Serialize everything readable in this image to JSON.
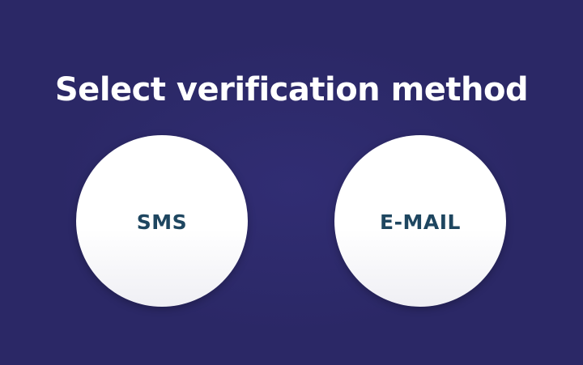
{
  "title": "Select verification method",
  "options": [
    {
      "label": "SMS"
    },
    {
      "label": "E-MAIL"
    }
  ],
  "colors": {
    "background": "#2b2866",
    "title_text": "#ffffff",
    "option_fill": "#ffffff",
    "option_text": "#1e4660"
  }
}
